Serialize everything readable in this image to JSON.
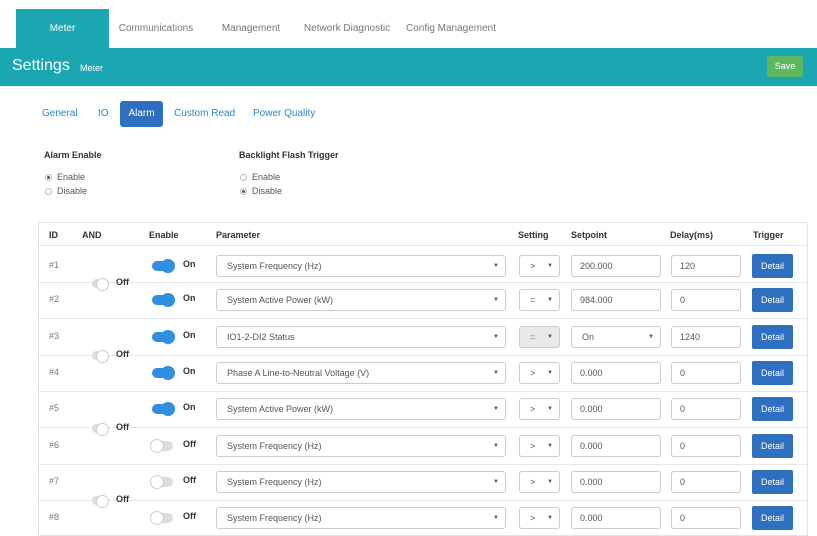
{
  "top_tabs": [
    "Meter",
    "Communications",
    "Management",
    "Network Diagnostic",
    "Config Management"
  ],
  "header": {
    "title": "Settings",
    "subtitle": "Meter",
    "save_label": "Save"
  },
  "sub_tabs": [
    "General",
    "IO",
    "Alarm",
    "Custom Read",
    "Power Quality"
  ],
  "alarm_enable": {
    "label": "Alarm Enable",
    "options": [
      "Enable",
      "Disable"
    ],
    "selected": "Enable"
  },
  "backlight": {
    "label": "Backlight Flash Trigger",
    "options": [
      "Enable",
      "Disable"
    ],
    "selected": "Disable"
  },
  "columns": {
    "id": "ID",
    "and": "AND",
    "enable": "Enable",
    "parameter": "Parameter",
    "setting": "Setting",
    "setpoint": "Setpoint",
    "delay": "Delay(ms)",
    "trigger": "Trigger"
  },
  "and_groups": [
    {
      "label": "Off"
    },
    {
      "label": "Off"
    },
    {
      "label": "Off"
    },
    {
      "label": "Off"
    }
  ],
  "rows": [
    {
      "id": "#1",
      "enable": "On",
      "parameter": "System Frequency (Hz)",
      "setting": ">",
      "setpoint": "200.000",
      "delay": "120",
      "trigger": "Detail"
    },
    {
      "id": "#2",
      "enable": "On",
      "parameter": "System Active Power (kW)",
      "setting": "=",
      "setpoint": "984.000",
      "delay": "0",
      "trigger": "Detail"
    },
    {
      "id": "#3",
      "enable": "On",
      "parameter": "IO1-2-DI2 Status",
      "setting": "=",
      "setpoint": "On",
      "delay": "1240",
      "trigger": "Detail"
    },
    {
      "id": "#4",
      "enable": "On",
      "parameter": "Phase A Line-to-Neutral Voltage (V)",
      "setting": ">",
      "setpoint": "0.000",
      "delay": "0",
      "trigger": "Detail"
    },
    {
      "id": "#5",
      "enable": "On",
      "parameter": "System Active Power (kW)",
      "setting": ">",
      "setpoint": "0.000",
      "delay": "0",
      "trigger": "Detail"
    },
    {
      "id": "#6",
      "enable": "Off",
      "parameter": "System Frequency (Hz)",
      "setting": ">",
      "setpoint": "0.000",
      "delay": "0",
      "trigger": "Detail"
    },
    {
      "id": "#7",
      "enable": "Off",
      "parameter": "System Frequency (Hz)",
      "setting": ">",
      "setpoint": "0.000",
      "delay": "0",
      "trigger": "Detail"
    },
    {
      "id": "#8",
      "enable": "Off",
      "parameter": "System Frequency (Hz)",
      "setting": ">",
      "setpoint": "0.000",
      "delay": "0",
      "trigger": "Detail"
    }
  ],
  "colors": {
    "teal": "#1aa7b2",
    "blue": "#2f6fbf",
    "green": "#5cb85c",
    "toggle_on": "#2f8fe0"
  }
}
